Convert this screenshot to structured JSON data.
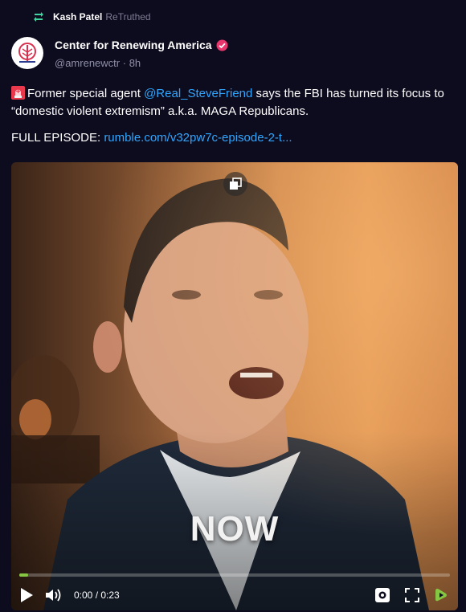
{
  "retruth": {
    "user": "Kash Patel",
    "tag": "ReTruthed"
  },
  "account": {
    "name": "Center for Renewing America",
    "handle": "@amrenewctr",
    "time": "8h"
  },
  "post": {
    "text_before": "Former special agent ",
    "mention": "@Real_SteveFriend",
    "text_after": " says the FBI has turned its focus to “domestic violent extremism” a.k.a. MAGA Republicans.",
    "full_episode_label": "FULL EPISODE: ",
    "link": "rumble.com/v32pw7c-episode-2-t..."
  },
  "video": {
    "overlay_text": "NOW",
    "current_time": "0:00",
    "duration": "0:23",
    "time_display": "0:00 / 0:23",
    "progress_fraction": 0.02
  },
  "colors": {
    "background": "#0d0b1e",
    "link": "#2fa7ff",
    "accent_green": "#85c742",
    "verified": "#e6366b"
  },
  "icons": [
    "retruth-icon",
    "verified-icon",
    "alert-emoji-icon",
    "popout-icon",
    "play-icon",
    "volume-icon",
    "settings-icon",
    "fullscreen-icon",
    "rumble-icon"
  ]
}
